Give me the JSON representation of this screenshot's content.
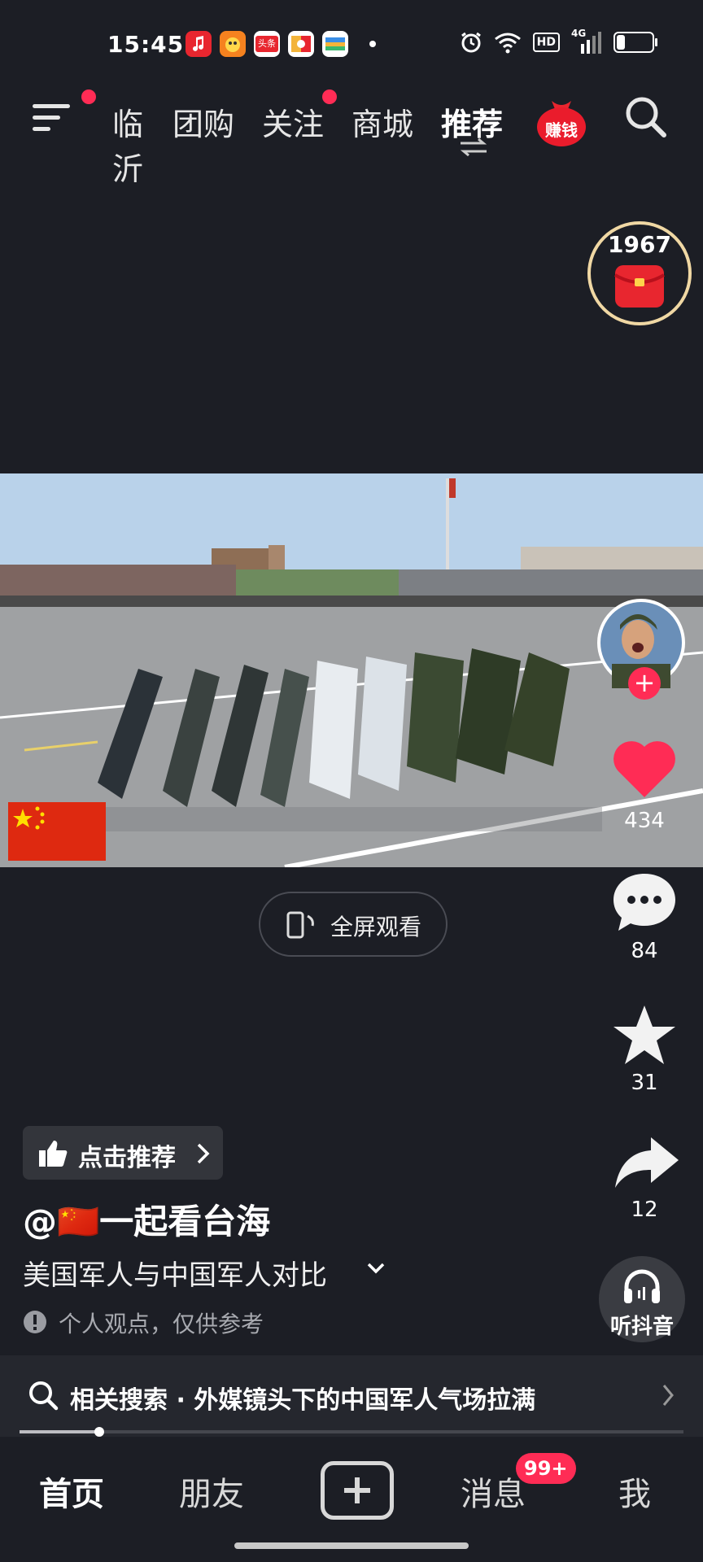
{
  "status_bar": {
    "time": "15:45",
    "app_icons": [
      {
        "name": "music-app-icon",
        "color": "#e8262f"
      },
      {
        "name": "shopping-app-icon",
        "color": "#f5821f"
      },
      {
        "name": "toutiao-app-icon",
        "color": "#e8262f",
        "label": "头条"
      },
      {
        "name": "game-app-icon",
        "color": "#f3b43a"
      },
      {
        "name": "wallet-app-icon",
        "color": "#3a8ee6"
      }
    ],
    "network": "HD",
    "signal": "4G"
  },
  "top_nav": {
    "tabs": [
      "临沂",
      "团购",
      "关注",
      "商城",
      "推荐"
    ],
    "earn_badge": "赚钱"
  },
  "red_packet_timer": "1967",
  "video": {
    "fullscreen_label": "全屏观看"
  },
  "rail": {
    "likes": "434",
    "comments": "84",
    "favorites": "31",
    "shares": "12",
    "listen_label": "听抖音"
  },
  "post": {
    "recommend_label": "点击推荐",
    "author": "@🇨🇳一起看台海",
    "caption": "美国军人与中国军人对比",
    "disclaimer": "个人观点，仅供参考"
  },
  "related_search": {
    "text": "相关搜索 · 外媒镜头下的中国军人气场拉满"
  },
  "progress": 0.12,
  "bottom_nav": {
    "home": "首页",
    "friends": "朋友",
    "messages": "消息",
    "messages_badge": "99+",
    "me": "我"
  },
  "colors": {
    "background": "#1c1e25",
    "accent_red": "#ff2c55",
    "flag_red": "#de2910",
    "flag_yellow": "#ffde00"
  }
}
